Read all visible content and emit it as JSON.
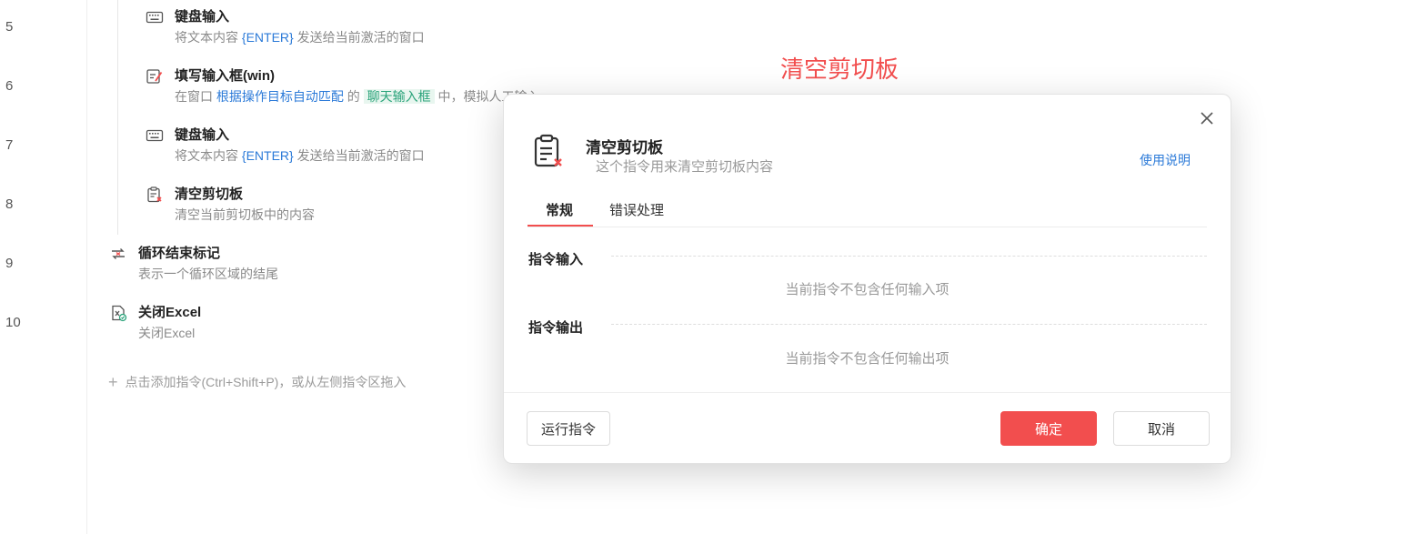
{
  "line_numbers": [
    "5",
    "6",
    "7",
    "8",
    "9",
    "10"
  ],
  "steps": [
    {
      "icon": "keyboard-icon",
      "title": "键盘输入",
      "desc": [
        {
          "t": "将文本内容 ",
          "s": "plain"
        },
        {
          "t": "{ENTER}",
          "s": "blue"
        },
        {
          "t": " 发送给当前激活的窗口",
          "s": "plain"
        }
      ]
    },
    {
      "icon": "fill-input-icon",
      "title": "填写输入框(win)",
      "desc": [
        {
          "t": "在窗口 ",
          "s": "plain"
        },
        {
          "t": "根据操作目标自动匹配",
          "s": "blue"
        },
        {
          "t": " 的 ",
          "s": "plain"
        },
        {
          "t": "聊天输入框",
          "s": "green"
        },
        {
          "t": " 中，模拟人工输入 ",
          "s": "plain"
        }
      ]
    },
    {
      "icon": "keyboard-icon",
      "title": "键盘输入",
      "desc": [
        {
          "t": "将文本内容 ",
          "s": "plain"
        },
        {
          "t": "{ENTER}",
          "s": "blue"
        },
        {
          "t": " 发送给当前激活的窗口",
          "s": "plain"
        }
      ]
    },
    {
      "icon": "clear-clipboard-icon",
      "title": "清空剪切板",
      "desc": [
        {
          "t": "清空当前剪切板中的内容",
          "s": "plain"
        }
      ]
    },
    {
      "icon": "loop-end-icon",
      "title": "循环结束标记",
      "desc": [
        {
          "t": "表示一个循环区域的结尾",
          "s": "plain"
        }
      ]
    },
    {
      "icon": "close-excel-icon",
      "title": "关闭Excel",
      "desc": [
        {
          "t": "关闭Excel",
          "s": "plain"
        }
      ]
    }
  ],
  "add_command": "点击添加指令(Ctrl+Shift+P)，或从左侧指令区拖入",
  "overlay_caption": "清空剪切板",
  "dialog": {
    "title": "清空剪切板",
    "subtitle": "这个指令用来清空剪切板内容",
    "help_link": "使用说明",
    "tabs": [
      "常规",
      "错误处理"
    ],
    "active_tab": "常规",
    "input_section": "指令输入",
    "input_empty": "当前指令不包含任何输入项",
    "output_section": "指令输出",
    "output_empty": "当前指令不包含任何输出项",
    "run_button": "运行指令",
    "ok_button": "确定",
    "cancel_button": "取消"
  },
  "colors": {
    "accent": "#f24e4e",
    "link": "#2b7ad8",
    "token_green": "#2aa37a"
  }
}
